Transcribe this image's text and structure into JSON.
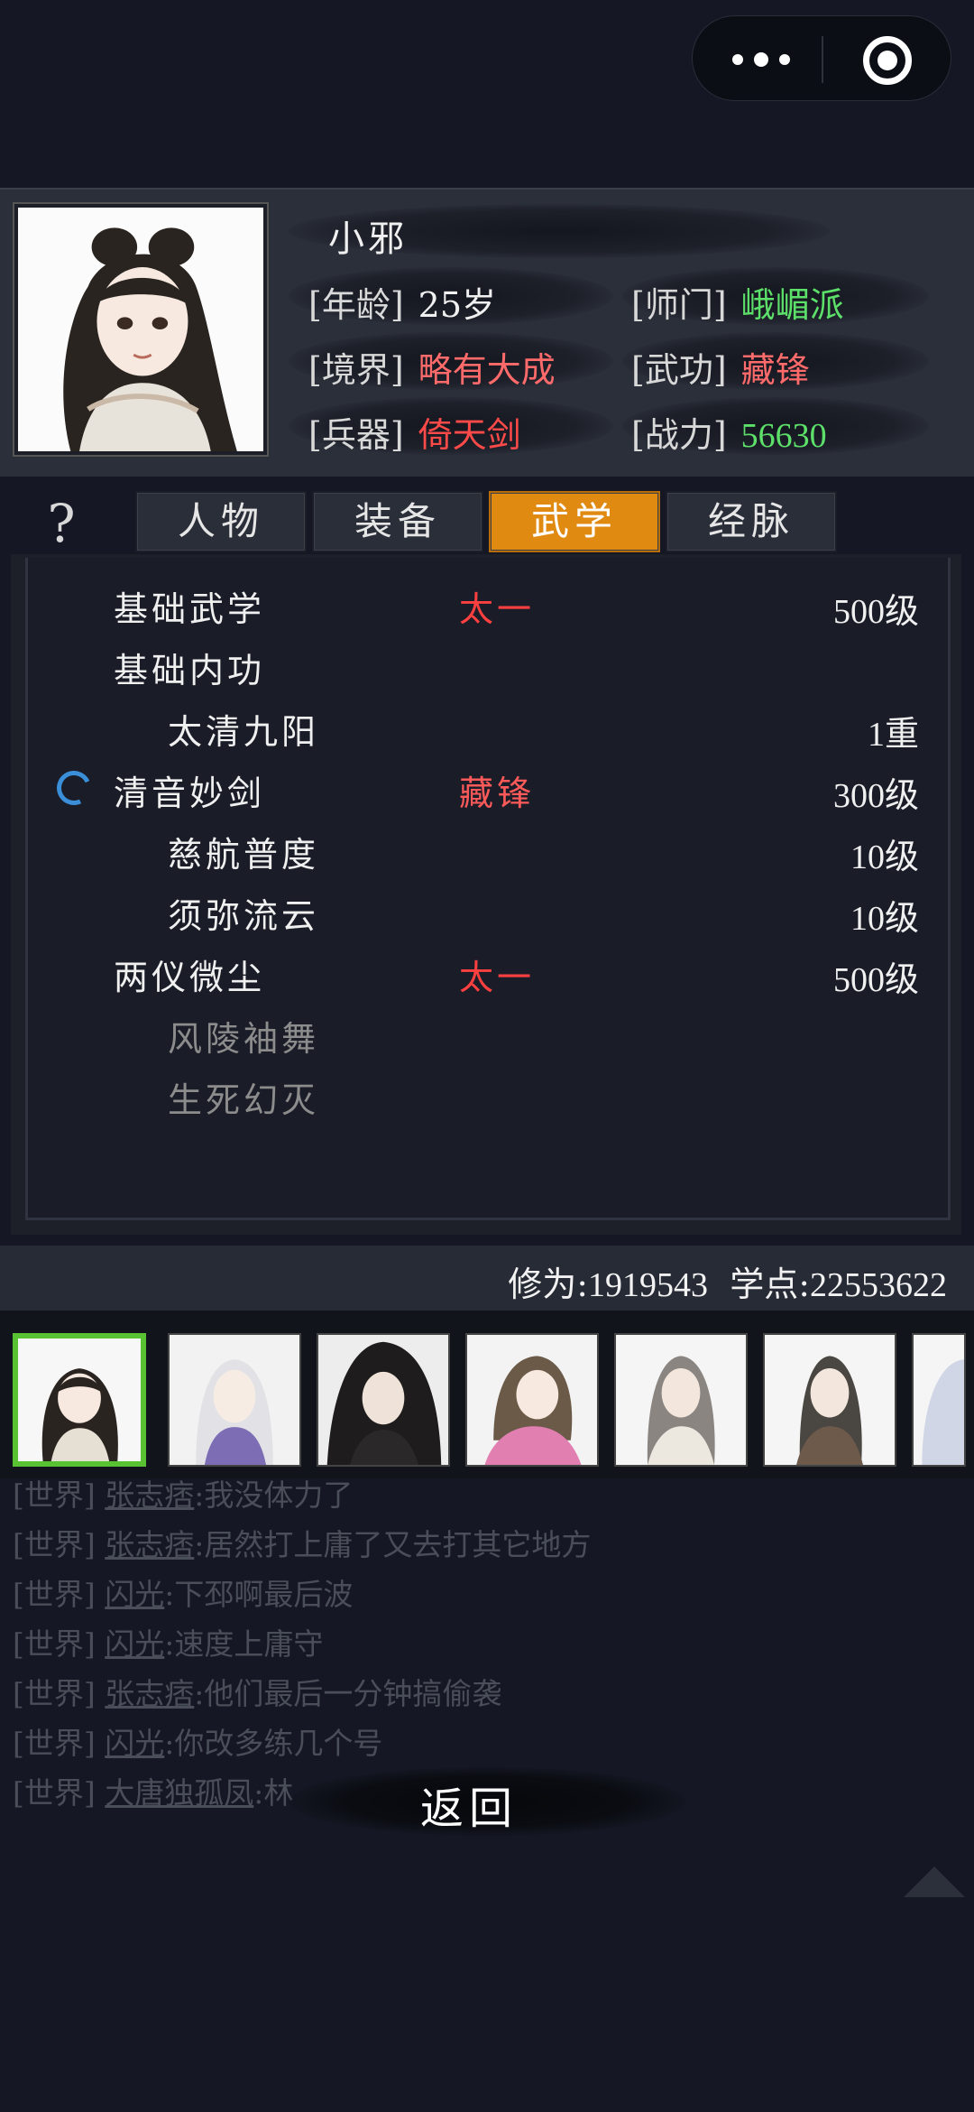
{
  "character": {
    "name": "小邪",
    "age_label": "[年龄]",
    "age": "25岁",
    "sect_label": "[师门]",
    "sect": "峨嵋派",
    "realm_label": "[境界]",
    "realm": "略有大成",
    "skill_label": "[武功]",
    "skill": "藏锋",
    "weapon_label": "[兵器]",
    "weapon": "倚天剑",
    "power_label": "[战力]",
    "power": "56630"
  },
  "help_icon": "?",
  "tabs": [
    "人物",
    "装备",
    "武学",
    "经脉"
  ],
  "active_tab": "武学",
  "skills": [
    {
      "name": "基础武学",
      "style": "太一",
      "level": "500级",
      "indent": false,
      "dim": false,
      "loading": false
    },
    {
      "name": "基础内功",
      "style": "",
      "level": "",
      "indent": false,
      "dim": false,
      "loading": false
    },
    {
      "name": "太清九阳",
      "style": "",
      "level": "1重",
      "indent": true,
      "dim": false,
      "loading": false
    },
    {
      "name": "清音妙剑",
      "style": "藏锋",
      "level": "300级",
      "indent": false,
      "dim": false,
      "loading": true
    },
    {
      "name": "慈航普度",
      "style": "",
      "level": "10级",
      "indent": true,
      "dim": false,
      "loading": false
    },
    {
      "name": "须弥流云",
      "style": "",
      "level": "10级",
      "indent": true,
      "dim": false,
      "loading": false
    },
    {
      "name": "两仪微尘",
      "style": "太一",
      "level": "500级",
      "indent": false,
      "dim": false,
      "loading": false
    },
    {
      "name": "风陵袖舞",
      "style": "",
      "level": "",
      "indent": true,
      "dim": true,
      "loading": false
    },
    {
      "name": "生死幻灭",
      "style": "",
      "level": "",
      "indent": true,
      "dim": true,
      "loading": false
    }
  ],
  "stats": {
    "cultivation_label": "修为:",
    "cultivation": "1919543",
    "points_label": "学点:",
    "points": "22553622"
  },
  "chat": [
    {
      "channel": "[世界]",
      "who": "张志痞",
      "msg": ":我没体力了"
    },
    {
      "channel": "[世界]",
      "who": "张志痞",
      "msg": ":居然打上庸了又去打其它地方"
    },
    {
      "channel": "[世界]",
      "who": "闪光",
      "msg": ":下邳啊最后波"
    },
    {
      "channel": "[世界]",
      "who": "闪光",
      "msg": ":速度上庸守"
    },
    {
      "channel": "[世界]",
      "who": "张志痞",
      "msg": ":他们最后一分钟搞偷袭"
    },
    {
      "channel": "[世界]",
      "who": "闪光",
      "msg": ":你改多练几个号"
    },
    {
      "channel": "[世界]",
      "who": "大唐独孤凤",
      "msg": ":林"
    }
  ],
  "back_label": "返回",
  "colors": {
    "accent": "#e08a12",
    "green": "#5de06a",
    "red": "#ff4a4a",
    "roster_selected": "#58c232"
  }
}
